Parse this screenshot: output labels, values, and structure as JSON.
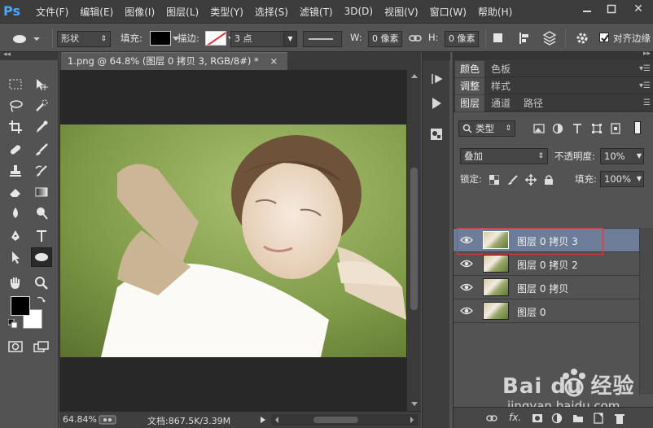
{
  "app": {
    "logo": "Ps"
  },
  "menu": [
    "文件(F)",
    "编辑(E)",
    "图像(I)",
    "图层(L)",
    "类型(Y)",
    "选择(S)",
    "滤镜(T)",
    "3D(D)",
    "视图(V)",
    "窗口(W)",
    "帮助(H)"
  ],
  "window_controls": {
    "minimize": "▭",
    "maximize": "▭",
    "close": "✕"
  },
  "options": {
    "shape_mode": "形状",
    "fill_label": "填充:",
    "stroke_label": "描边:",
    "stroke_width": "3 点",
    "w_label": "W:",
    "w_value": "0 像素",
    "h_label": "H:",
    "h_value": "0 像素",
    "align_edges": "对齐边缘",
    "align_checked": true
  },
  "document": {
    "tab_title": "1.png @ 64.8% (图层 0 拷贝 3, RGB/8#) *",
    "tab_close": "×",
    "zoom": "64.84%",
    "doc_info": "文档:867.5K/3.39M"
  },
  "panels": {
    "row1": [
      "颜色",
      "色板"
    ],
    "row2": [
      "调整",
      "样式"
    ],
    "row3": [
      "图层",
      "通道",
      "路径"
    ]
  },
  "layers": {
    "filter_kind": "类型",
    "blend_mode": "叠加",
    "opacity_label": "不透明度:",
    "opacity_value": "10%",
    "lock_label": "锁定:",
    "fill_label": "填充:",
    "fill_value": "100%",
    "items": [
      {
        "name": "图层 0 拷贝 3",
        "selected": true
      },
      {
        "name": "图层 0 拷贝 2",
        "selected": false
      },
      {
        "name": "图层 0 拷贝",
        "selected": false
      },
      {
        "name": "图层 0",
        "selected": false
      }
    ]
  },
  "watermark": {
    "brand": "Bai du 经验",
    "url": "jingyan.baidu.com"
  },
  "colors": {
    "selection_highlight": "#6d7d99",
    "selection_outline": "#e0353a",
    "foreground": "#000000",
    "background": "#ffffff"
  }
}
